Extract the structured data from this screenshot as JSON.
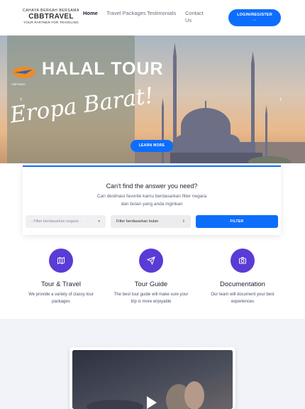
{
  "logo": {
    "tagline_top": "CAHAYA BERKAH BERSAMA",
    "brand": "CBBTRAVEL",
    "tagline_bottom": "YOUR PARTNER FOR TRAVELING"
  },
  "nav": {
    "items": [
      {
        "label": "Home",
        "active": true
      },
      {
        "label": "Travel Packages"
      },
      {
        "label": "Testimonials"
      },
      {
        "label": "Contact Us"
      }
    ],
    "login_label": "LOGIN/REGISTER",
    "login_arrow": "→"
  },
  "hero": {
    "title": "HALAL TOUR",
    "subtitle": "Eropa Barat!",
    "mini_logo_text": "CBBTRAVEL",
    "prev_arrow": "‹",
    "next_arrow": "›",
    "cta_label": "LEARN MORE"
  },
  "search": {
    "title": "Can't find the answer you need?",
    "subtitle": "Cari destinasi favorite kamu berdasarkan filter negara dan bulan yang anda inginkan",
    "country_placeholder": "- Filter berdasarkan negara -",
    "month_placeholder": "Filter berdasarkan bulan",
    "filter_label": "FILTER"
  },
  "features": [
    {
      "icon": "map-icon",
      "title": "Tour & Travel",
      "desc": "We provide a variety of classy tour packages"
    },
    {
      "icon": "send-icon",
      "title": "Tour Guide",
      "desc": "The best tour guide will make sure your trip is more enjoyable"
    },
    {
      "icon": "camera-icon",
      "title": "Documentation",
      "desc": "Our team will document your best experiences"
    }
  ],
  "colors": {
    "primary": "#0d6efd",
    "icon_bg": "#5a3bd6",
    "section_bg": "#f1f3f8",
    "brand_accent": "#f0a020"
  }
}
